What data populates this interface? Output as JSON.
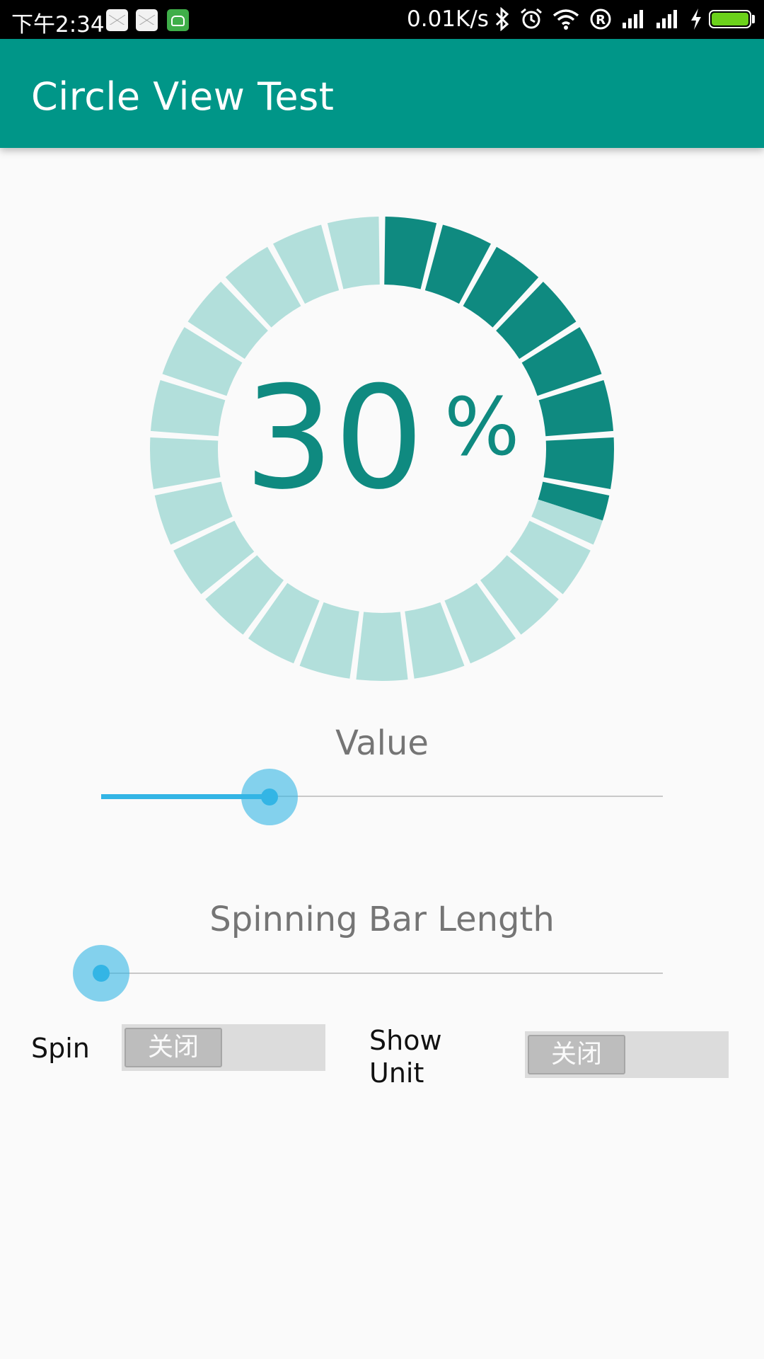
{
  "status_bar": {
    "time": "下午2:34",
    "network_speed": "0.01K/s",
    "icons": [
      "mail-icon",
      "mail-icon",
      "robot-icon",
      "bluetooth-icon",
      "alarm-icon",
      "wifi-icon",
      "registered-icon",
      "signal-icon",
      "signal-icon",
      "charging-icon",
      "battery-icon"
    ],
    "battery_color": "#6bd11b"
  },
  "app_bar": {
    "title": "Circle View Test",
    "color": "#009688"
  },
  "circle": {
    "value": 30,
    "value_text": "30",
    "unit": "%",
    "segments": 25,
    "active_color": "#0f8a80",
    "inactive_color": "#b2dfdb"
  },
  "value_slider": {
    "label": "Value",
    "level": 0.3,
    "color": "#33b5e5"
  },
  "spin_length_slider": {
    "label": "Spinning Bar Length",
    "level": 0
  },
  "spin_switch": {
    "label": "Spin",
    "state_text": "关闭"
  },
  "unit_switch": {
    "label_line1": "Show",
    "label_line2": "Unit",
    "state_text": "关闭"
  }
}
